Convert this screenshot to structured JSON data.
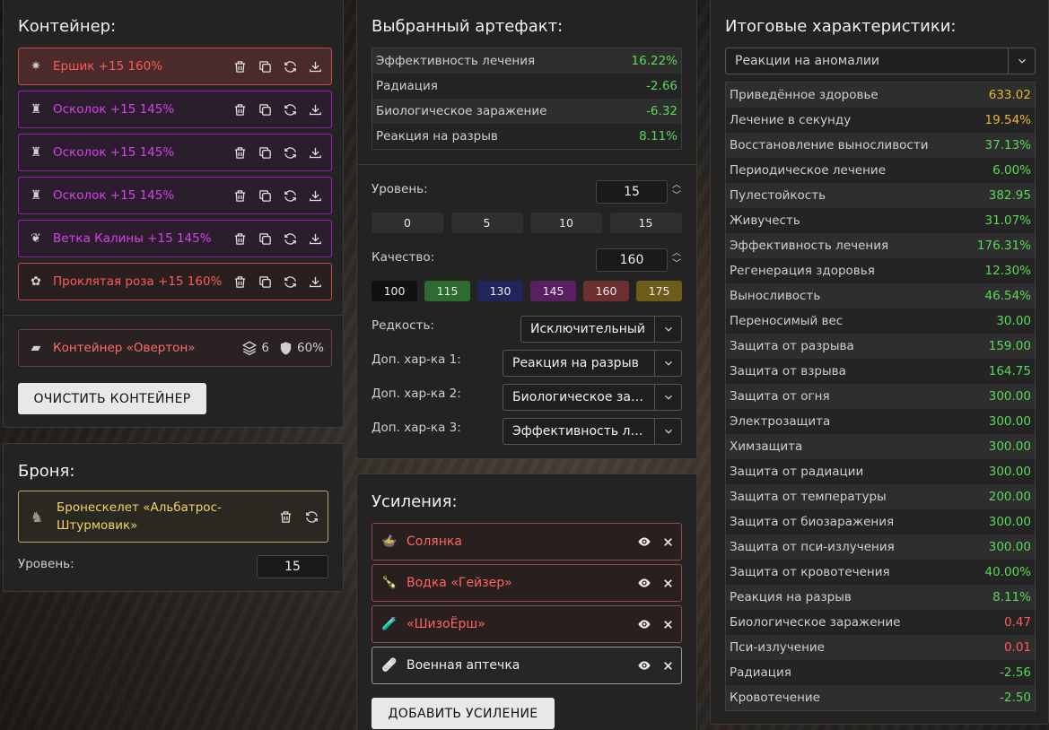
{
  "container": {
    "title": "Контейнер:",
    "slots": [
      {
        "name": "Ершик +15 160%",
        "color": "red",
        "icon": "artifact-spiky-icon",
        "glyph": "✷"
      },
      {
        "name": "Осколок +15 145%",
        "color": "purple",
        "icon": "artifact-shard-icon",
        "glyph": "♜"
      },
      {
        "name": "Осколок +15 145%",
        "color": "purple",
        "icon": "artifact-shard-icon",
        "glyph": "♜"
      },
      {
        "name": "Осколок +15 145%",
        "color": "purple",
        "icon": "artifact-shard-icon",
        "glyph": "♜"
      },
      {
        "name": "Ветка Калины +15 145%",
        "color": "purple",
        "icon": "artifact-branch-icon",
        "glyph": "❦"
      },
      {
        "name": "Проклятая роза +15 160%",
        "color": "red",
        "icon": "artifact-rose-icon",
        "glyph": "✿"
      }
    ],
    "container_item": {
      "name": "Контейнер «Овертон»",
      "slots": "6",
      "protection": "60%"
    },
    "clear_button": "ОЧИСТИТЬ КОНТЕЙНЕР"
  },
  "armor": {
    "title": "Броня:",
    "item_line1": "Бронескелет «Альбатрос-",
    "item_line2": "Штурмовик»",
    "level_label": "Уровень:",
    "level_value": "15"
  },
  "artifact": {
    "title": "Выбранный артефакт:",
    "stats": [
      {
        "k": "Эффективность лечения",
        "v": "16.22%",
        "tone": "green"
      },
      {
        "k": "Радиация",
        "v": "-2.66",
        "tone": "green"
      },
      {
        "k": "Биологическое заражение",
        "v": "-6.32",
        "tone": "green"
      },
      {
        "k": "Реакция на разрыв",
        "v": "8.11%",
        "tone": "green"
      }
    ],
    "level_label": "Уровень:",
    "level_value": "15",
    "level_chips": [
      "0",
      "5",
      "10",
      "15"
    ],
    "quality_label": "Качество:",
    "quality_value": "160",
    "quality_chips": [
      {
        "label": "100",
        "color": "#111111"
      },
      {
        "label": "115",
        "color": "#2e6b2e"
      },
      {
        "label": "130",
        "color": "#22255c"
      },
      {
        "label": "145",
        "color": "#5a1f62"
      },
      {
        "label": "160",
        "color": "#6d2f2f"
      },
      {
        "label": "175",
        "color": "#6b5c1a"
      }
    ],
    "rarity_label": "Редкость:",
    "rarity_value": "Исключительный",
    "extra1_label": "Доп. хар-ка 1:",
    "extra1_value": "Реакция на разрыв",
    "extra2_label": "Доп. хар-ка 2:",
    "extra2_value": "Биологическое заражение",
    "extra3_label": "Доп. хар-ка 3:",
    "extra3_value": "Эффективность лечения"
  },
  "boosts": {
    "title": "Усиления:",
    "items": [
      {
        "name": "Солянка",
        "style": "red",
        "icon": "soup-bowl-icon",
        "glyph": "🍲"
      },
      {
        "name": "Водка «Гейзер»",
        "style": "red",
        "icon": "bottle-icon",
        "glyph": "🍾"
      },
      {
        "name": "«ШизоЁрш»",
        "style": "red",
        "icon": "energy-drink-icon",
        "glyph": "🧪"
      },
      {
        "name": "Военная аптечка",
        "style": "white",
        "icon": "medkit-icon",
        "glyph": "🩹"
      }
    ],
    "add_button": "ДОБАВИТЬ УСИЛЕНИЕ"
  },
  "totals": {
    "title": "Итоговые характеристики:",
    "filter_value": "Реакции на аномалии",
    "stats": [
      {
        "k": "Приведённое здоровье",
        "v": "633.02",
        "tone": "gold"
      },
      {
        "k": "Лечение в секунду",
        "v": "19.54%",
        "tone": "gold"
      },
      {
        "k": "Восстановление выносливости",
        "v": "37.13%",
        "tone": "green"
      },
      {
        "k": "Периодическое лечение",
        "v": "6.00%",
        "tone": "green"
      },
      {
        "k": "Пулестойкость",
        "v": "382.95",
        "tone": "green"
      },
      {
        "k": "Живучесть",
        "v": "31.07%",
        "tone": "green"
      },
      {
        "k": "Эффективность лечения",
        "v": "176.31%",
        "tone": "green"
      },
      {
        "k": "Регенерация здоровья",
        "v": "12.30%",
        "tone": "green"
      },
      {
        "k": "Выносливость",
        "v": "46.54%",
        "tone": "green"
      },
      {
        "k": "Переносимый вес",
        "v": "30.00",
        "tone": "green"
      },
      {
        "k": "Защита от разрыва",
        "v": "159.00",
        "tone": "green"
      },
      {
        "k": "Защита от взрыва",
        "v": "164.75",
        "tone": "green"
      },
      {
        "k": "Защита от огня",
        "v": "300.00",
        "tone": "green"
      },
      {
        "k": "Электрозащита",
        "v": "300.00",
        "tone": "green"
      },
      {
        "k": "Химзащита",
        "v": "300.00",
        "tone": "green"
      },
      {
        "k": "Защита от радиации",
        "v": "300.00",
        "tone": "green"
      },
      {
        "k": "Защита от температуры",
        "v": "200.00",
        "tone": "green"
      },
      {
        "k": "Защита от биозаражения",
        "v": "300.00",
        "tone": "green"
      },
      {
        "k": "Защита от пси-излучения",
        "v": "300.00",
        "tone": "green"
      },
      {
        "k": "Защита от кровотечения",
        "v": "40.00%",
        "tone": "green"
      },
      {
        "k": "Реакция на разрыв",
        "v": "8.11%",
        "tone": "green"
      },
      {
        "k": "Биологическое заражение",
        "v": "0.47",
        "tone": "red"
      },
      {
        "k": "Пси-излучение",
        "v": "0.01",
        "tone": "red"
      },
      {
        "k": "Радиация",
        "v": "-2.56",
        "tone": "green"
      },
      {
        "k": "Кровотечение",
        "v": "-2.50",
        "tone": "green"
      }
    ]
  }
}
